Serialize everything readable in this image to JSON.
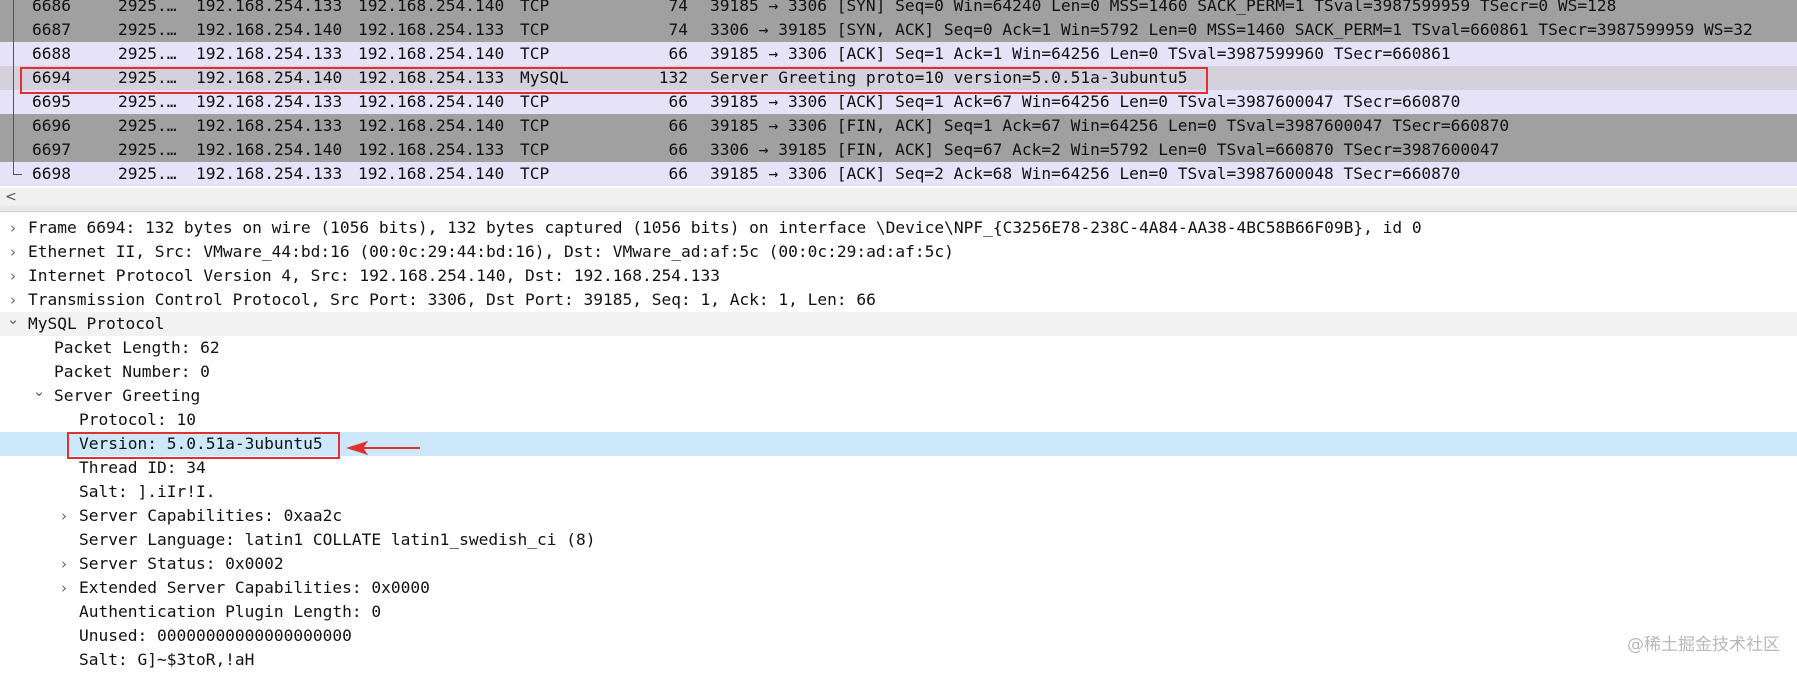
{
  "packet_list": {
    "rows": [
      {
        "no": "6686",
        "time": "2925.…",
        "src": "192.168.254.133",
        "dst": "192.168.254.140",
        "proto": "TCP",
        "len": "74",
        "info": "39185 → 3306 [SYN] Seq=0 Win=64240 Len=0 MSS=1460 SACK_PERM=1 TSval=3987599959 TSecr=0 WS=128",
        "style": "gray"
      },
      {
        "no": "6687",
        "time": "2925.…",
        "src": "192.168.254.140",
        "dst": "192.168.254.133",
        "proto": "TCP",
        "len": "74",
        "info": "3306 → 39185 [SYN, ACK] Seq=0 Ack=1 Win=5792 Len=0 MSS=1460 SACK_PERM=1 TSval=660861 TSecr=3987599959 WS=32",
        "style": "gray"
      },
      {
        "no": "6688",
        "time": "2925.…",
        "src": "192.168.254.133",
        "dst": "192.168.254.140",
        "proto": "TCP",
        "len": "66",
        "info": "39185 → 3306 [ACK] Seq=1 Ack=1 Win=64256 Len=0 TSval=3987599960 TSecr=660861",
        "style": "lav"
      },
      {
        "no": "6694",
        "time": "2925.…",
        "src": "192.168.254.140",
        "dst": "192.168.254.133",
        "proto": "MySQL",
        "len": "132",
        "info": "Server Greeting proto=10 version=5.0.51a-3ubuntu5",
        "style": "sel"
      },
      {
        "no": "6695",
        "time": "2925.…",
        "src": "192.168.254.133",
        "dst": "192.168.254.140",
        "proto": "TCP",
        "len": "66",
        "info": "39185 → 3306 [ACK] Seq=1 Ack=67 Win=64256 Len=0 TSval=3987600047 TSecr=660870",
        "style": "lav"
      },
      {
        "no": "6696",
        "time": "2925.…",
        "src": "192.168.254.133",
        "dst": "192.168.254.140",
        "proto": "TCP",
        "len": "66",
        "info": "39185 → 3306 [FIN, ACK] Seq=1 Ack=67 Win=64256 Len=0 TSval=3987600047 TSecr=660870",
        "style": "gray"
      },
      {
        "no": "6697",
        "time": "2925.…",
        "src": "192.168.254.140",
        "dst": "192.168.254.133",
        "proto": "TCP",
        "len": "66",
        "info": "3306 → 39185 [FIN, ACK] Seq=67 Ack=2 Win=5792 Len=0 TSval=660870 TSecr=3987600047",
        "style": "gray"
      },
      {
        "no": "6698",
        "time": "2925.…",
        "src": "192.168.254.133",
        "dst": "192.168.254.140",
        "proto": "TCP",
        "len": "66",
        "info": "39185 → 3306 [ACK] Seq=2 Ack=68 Win=64256 Len=0 TSval=3987600048 TSecr=660870",
        "style": "lav"
      }
    ]
  },
  "scrollbar": {
    "left_arrow": "<"
  },
  "details": {
    "rows": [
      {
        "text": "Frame 6694: 132 bytes on wire (1056 bits), 132 bytes captured (1056 bits) on interface \\Device\\NPF_{C3256E78-238C-4A84-AA38-4BC58B66F09B}, id 0",
        "expander": "collapsed",
        "style": ""
      },
      {
        "text": "Ethernet II, Src: VMware_44:bd:16 (00:0c:29:44:bd:16), Dst: VMware_ad:af:5c (00:0c:29:ad:af:5c)",
        "expander": "collapsed",
        "style": ""
      },
      {
        "text": "Internet Protocol Version 4, Src: 192.168.254.140, Dst: 192.168.254.133",
        "expander": "collapsed",
        "style": ""
      },
      {
        "text": "Transmission Control Protocol, Src Port: 3306, Dst Port: 39185, Seq: 1, Ack: 1, Len: 66",
        "expander": "collapsed",
        "style": ""
      },
      {
        "text": "MySQL Protocol",
        "expander": "expanded",
        "style": "hover"
      },
      {
        "text": "Packet Length: 62",
        "expander": "none",
        "style": ""
      },
      {
        "text": "Packet Number: 0",
        "expander": "none",
        "style": ""
      },
      {
        "text": "Server Greeting",
        "expander": "expanded",
        "style": ""
      },
      {
        "text": "Protocol: 10",
        "expander": "none",
        "style": ""
      },
      {
        "text": "Version: 5.0.51a-3ubuntu5",
        "expander": "none",
        "style": "hl"
      },
      {
        "text": "Thread ID: 34",
        "expander": "none",
        "style": ""
      },
      {
        "text": "Salt: ].iIr!I.",
        "expander": "none",
        "style": ""
      },
      {
        "text": "Server Capabilities: 0xaa2c",
        "expander": "collapsed",
        "style": ""
      },
      {
        "text": "Server Language: latin1 COLLATE latin1_swedish_ci (8)",
        "expander": "none",
        "style": ""
      },
      {
        "text": "Server Status: 0x0002",
        "expander": "collapsed",
        "style": ""
      },
      {
        "text": "Extended Server Capabilities: 0x0000",
        "expander": "collapsed",
        "style": ""
      },
      {
        "text": "Authentication Plugin Length: 0",
        "expander": "none",
        "style": ""
      },
      {
        "text": "Unused: 00000000000000000000",
        "expander": "none",
        "style": ""
      },
      {
        "text": "Salt: G]~$3toR,!aH",
        "expander": "none",
        "style": ""
      }
    ]
  },
  "watermark": "@稀土掘金技术社区",
  "colors": {
    "annotation": "#e03030",
    "highlight": "#cde8fb",
    "row_gray": "#a0a0a0",
    "row_lavender": "#e6e2f8"
  }
}
